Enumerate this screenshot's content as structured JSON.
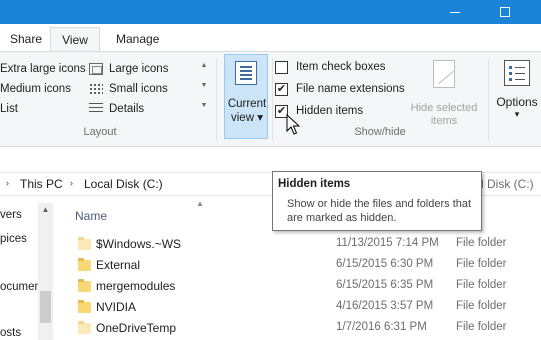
{
  "colors": {
    "titlebar": "#1883d7",
    "ribbon_bg": "#f5f6f7",
    "accent_selected": "#cce4f7"
  },
  "ribbon_tabs": [
    {
      "label": "Share"
    },
    {
      "label": "View",
      "active": true
    },
    {
      "label": "Manage"
    }
  ],
  "layout_group": {
    "label": "Layout",
    "items": [
      {
        "label": "Extra large icons",
        "icon": "large-icons-icon"
      },
      {
        "label": "Large icons",
        "icon": "large-icons-icon"
      },
      {
        "label": "Medium icons",
        "icon": "medium-icons-icon"
      },
      {
        "label": "Small icons",
        "icon": "small-icons-icon"
      },
      {
        "label": "List",
        "icon": "list-icon"
      },
      {
        "label": "Details",
        "icon": "details-icon"
      }
    ]
  },
  "current_view": {
    "label_line1": "Current",
    "label_line2": "view ▾",
    "icon": "current-view-icon"
  },
  "show_hide_group": {
    "label": "Show/hide",
    "checkboxes": [
      {
        "label": "Item check boxes",
        "checked": false,
        "mark": ""
      },
      {
        "label": "File name extensions",
        "checked": true,
        "mark": "✔"
      },
      {
        "label": "Hidden items",
        "checked": true,
        "mark": "✔"
      }
    ],
    "hide_selected": {
      "line1": "Hide selected",
      "line2": "items",
      "enabled": false
    }
  },
  "options": {
    "label": "Options",
    "dropdown": "▾"
  },
  "address": {
    "crumbs": [
      "This PC",
      "Local Disk (C:)"
    ],
    "separator": "›",
    "right_text": "l Disk (C:)"
  },
  "nav_pane": {
    "items": [
      "vers",
      "pices",
      "ocument",
      "osts"
    ]
  },
  "file_list": {
    "column_name": "Name",
    "rows": [
      {
        "name": "$Windows.~WS",
        "date": "11/13/2015 7:14 PM",
        "type": "File folder",
        "hidden": true
      },
      {
        "name": "External",
        "date": "6/15/2015 6:30 PM",
        "type": "File folder",
        "hidden": false
      },
      {
        "name": "mergemodules",
        "date": "6/15/2015 6:35 PM",
        "type": "File folder",
        "hidden": false
      },
      {
        "name": "NVIDIA",
        "date": "4/16/2015 3:57 PM",
        "type": "File folder",
        "hidden": false
      },
      {
        "name": "OneDriveTemp",
        "date": "1/7/2016 6:31 PM",
        "type": "File folder",
        "hidden": true
      }
    ]
  },
  "tooltip": {
    "title": "Hidden items",
    "body": "Show or hide the files and folders that are marked as hidden."
  }
}
